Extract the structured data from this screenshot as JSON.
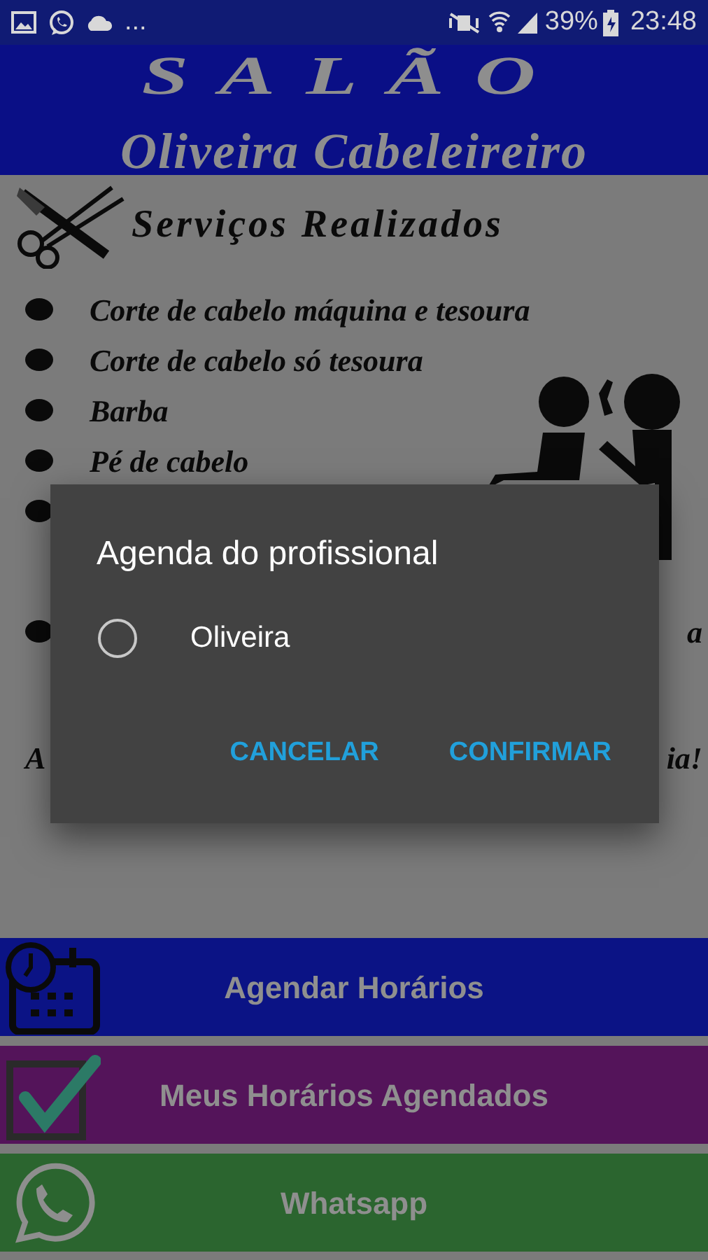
{
  "status_bar": {
    "overflow": "...",
    "battery": "39%",
    "time": "23:48"
  },
  "header": {
    "title": "SALÃO",
    "subtitle": "Oliveira Cabeleireiro"
  },
  "services": {
    "heading": "Serviços Realizados",
    "items": [
      "Corte de cabelo máquina e tesoura",
      "Corte de cabelo só tesoura",
      "Barba",
      "Pé de cabelo"
    ],
    "obscured_rows": [
      {
        "bullet": true
      },
      {
        "bullet": true,
        "right_text": "a"
      },
      {
        "bullet": false,
        "left_text": "A",
        "right_text": "ia!"
      }
    ]
  },
  "dialog": {
    "title": "Agenda do profissional",
    "options": [
      {
        "label": "Oliveira",
        "selected": false
      }
    ],
    "buttons": [
      "CANCELAR",
      "CONFIRMAR"
    ]
  },
  "menu_buttons": [
    {
      "label": "Agendar Horários",
      "kind": "calendar",
      "color": "#0b1385"
    },
    {
      "label": "Meus Horários Agendados",
      "kind": "check",
      "color": "#54145a"
    },
    {
      "label": "Whatsapp",
      "kind": "whatsapp",
      "color": "#2b652f"
    }
  ]
}
